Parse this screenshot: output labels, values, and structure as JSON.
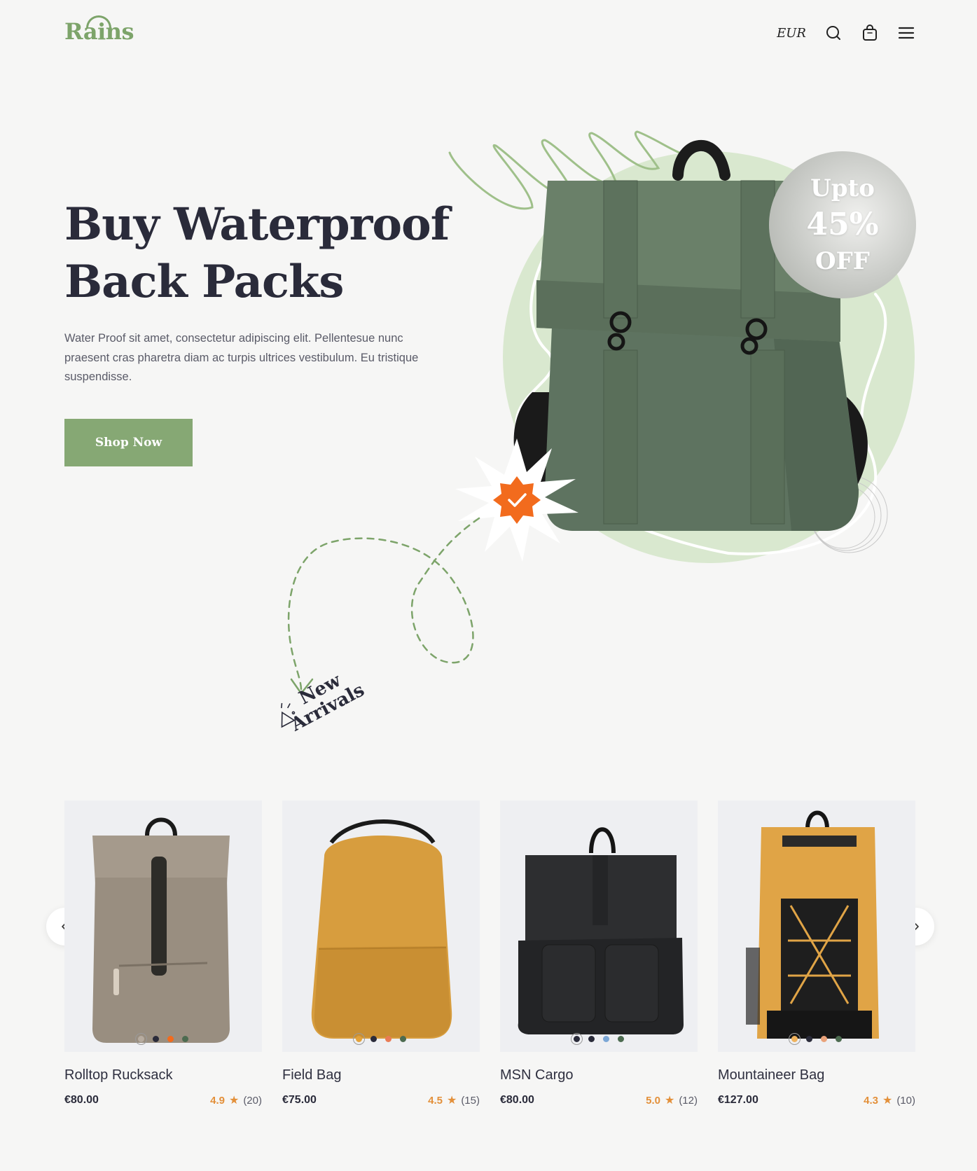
{
  "brand": {
    "logo_text": "Rains"
  },
  "header": {
    "currency": "EUR"
  },
  "hero": {
    "title_line1": "Buy Waterproof",
    "title_line2": "Back Packs",
    "description": "Water Proof sit amet, consectetur adipiscing elit. Pellentesue nunc praesent cras pharetra diam ac turpis ultrices vestibulum. Eu tristique suspendisse.",
    "cta_label": "Shop Now",
    "badge": {
      "line1": "Upto",
      "line2": "45%",
      "line3": "OFF"
    }
  },
  "section_label": {
    "line1": "New",
    "line2": "Arrivals"
  },
  "colors": {
    "accent_green": "#86a874",
    "rating_orange": "#e3903a",
    "badge_orange": "#f26b1d"
  },
  "products": [
    {
      "name": "Rolltop Rucksack",
      "price": "€80.00",
      "rating": "4.9",
      "reviews": "(20)",
      "swatches": [
        "#b7aca0",
        "#2a2b3a",
        "#f26b1d",
        "#4c6b50"
      ],
      "selected_swatch": 0
    },
    {
      "name": "Field Bag",
      "price": "€75.00",
      "rating": "4.5",
      "reviews": "(15)",
      "swatches": [
        "#e3a23a",
        "#2a2b3a",
        "#e97b55",
        "#4c6b50"
      ],
      "selected_swatch": 0
    },
    {
      "name": "MSN Cargo",
      "price": "€80.00",
      "rating": "5.0",
      "reviews": "(12)",
      "swatches": [
        "#2a2b3a",
        "#2a2b3a",
        "#7ba7d6",
        "#4c6b50"
      ],
      "selected_swatch": 0
    },
    {
      "name": "Mountaineer Bag",
      "price": "€127.00",
      "rating": "4.3",
      "reviews": "(10)",
      "swatches": [
        "#efb25c",
        "#2a2b3a",
        "#e9a27a",
        "#4c6b50"
      ],
      "selected_swatch": 0
    }
  ]
}
